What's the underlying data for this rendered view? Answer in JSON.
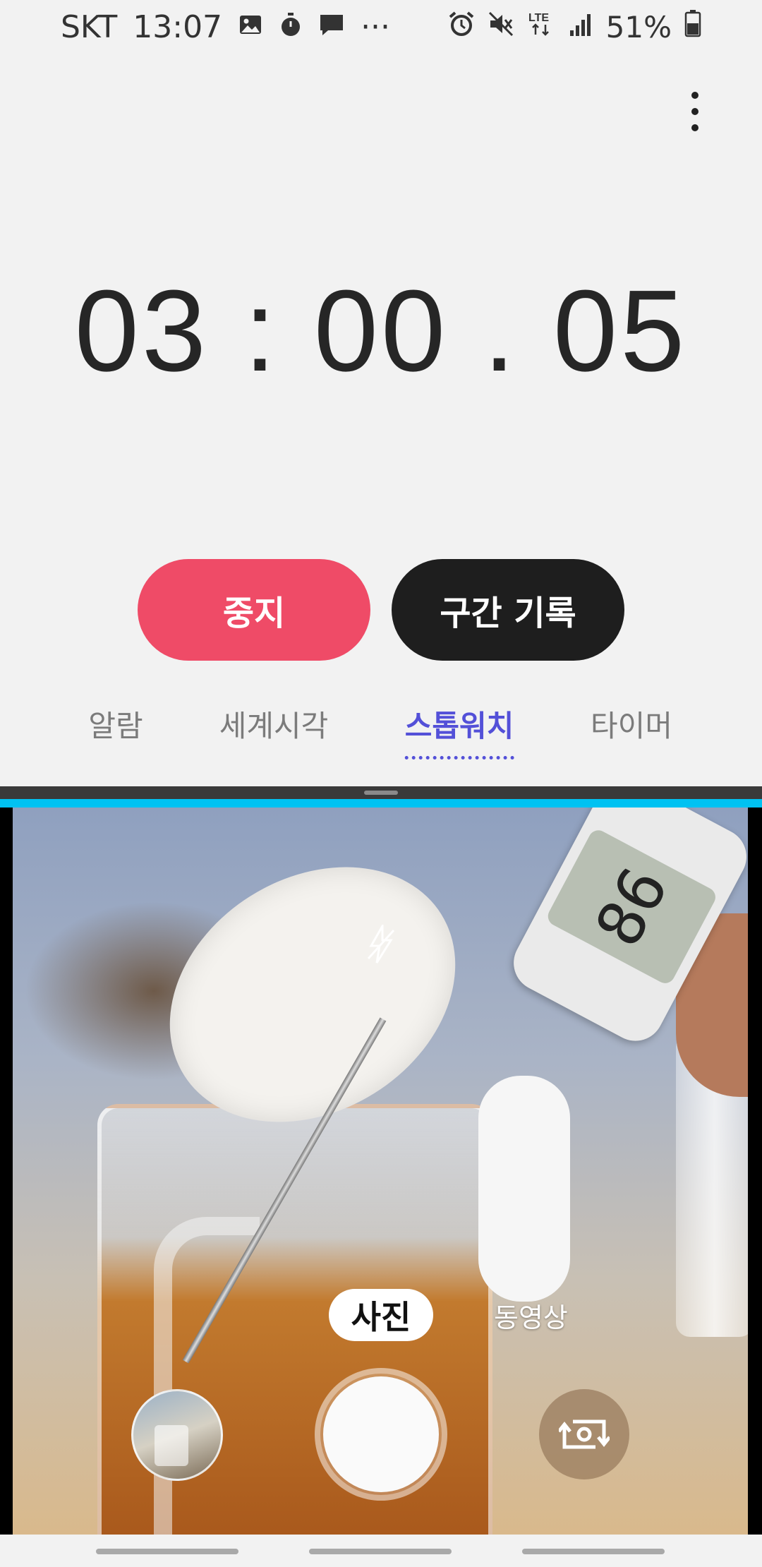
{
  "status_bar": {
    "carrier": "SKT",
    "time": "13:07",
    "more_indicator": "···",
    "network": "LTE",
    "battery_percent": "51%",
    "icons": [
      "image-icon",
      "stopwatch-icon",
      "message-icon",
      "alarm-icon",
      "mute-icon",
      "lte-icon",
      "signal-icon",
      "battery-icon"
    ]
  },
  "stopwatch": {
    "time": "03 : 00 . 05",
    "stop_label": "중지",
    "lap_label": "구간 기록"
  },
  "tabs": [
    {
      "label": "알람",
      "active": false
    },
    {
      "label": "세계시각",
      "active": false
    },
    {
      "label": "스톱워치",
      "active": true
    },
    {
      "label": "타이머",
      "active": false
    }
  ],
  "camera": {
    "thermometer_reading": "86",
    "modes": {
      "photo": "사진",
      "video": "동영상"
    },
    "selected_mode": "사진"
  },
  "colors": {
    "stop_button": "#ef4b67",
    "lap_button": "#1e1e1e",
    "active_tab": "#5350d8",
    "split_accent": "#00c2f2"
  }
}
